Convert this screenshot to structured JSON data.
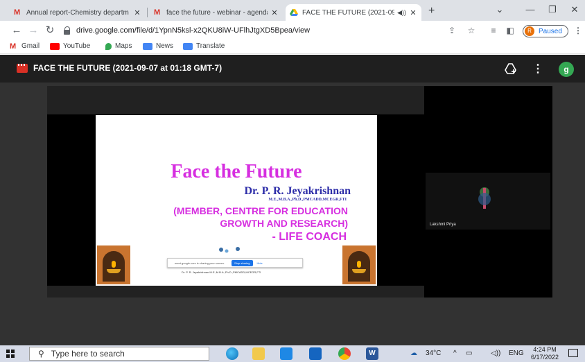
{
  "tabs": [
    {
      "title": "Annual report-Chemistry departm",
      "favicon": "gmail-icon"
    },
    {
      "title": "face the future - webinar - agenda",
      "favicon": "gmail-icon"
    },
    {
      "title": "FACE THE FUTURE (2021-09-",
      "favicon": "google-drive-icon",
      "active": true
    }
  ],
  "new_tab_label": "+",
  "address": {
    "url": "drive.google.com/file/d/1YpnN5ksl-x2QKU8iW-UFlhJtgXD5Bpea/view"
  },
  "profile": {
    "initial": "R",
    "status": "Paused"
  },
  "bookmarks": [
    "Gmail",
    "YouTube",
    "Maps",
    "News",
    "Translate"
  ],
  "viewer": {
    "file_title": "FACE THE FUTURE (2021-09-07 at 01:18 GMT-7)",
    "account_initial": "g"
  },
  "slide": {
    "heading": "Face the Future",
    "speaker": "Dr. P. R. Jeyakrishnan",
    "credentials": "M.E.,M.B.A.,Ph.D.,PMCADD,MCEGR,FTI",
    "role": "(MEMBER, CENTRE FOR EDUCATION GROWTH AND RESEARCH)",
    "role_line1": "(MEMBER, CENTRE FOR EDUCATION",
    "role_line2": "GROWTH AND RESEARCH)",
    "tagline": "- LIFE COACH",
    "footer": "Dr. P. R. Jeyakrishnan M.E.,M.B.A.,Ph.D.,PMCADD,MCEGR,FTI"
  },
  "share_bar": {
    "message": "meet.google.com is sharing your screen.",
    "stop_label": "Stop sharing",
    "hide_label": "Hide"
  },
  "participant": {
    "name": "Lakshmi Priya"
  },
  "taskbar": {
    "search_placeholder": "Type here to search",
    "weather": "34°C",
    "language": "ENG",
    "time": "4:24 PM",
    "date": "6/17/2022"
  },
  "colors": {
    "slide_pink": "#d62ee0",
    "slide_blue": "#2c2ca8",
    "paused_blue": "#1a73e8",
    "account_green": "#34a853"
  }
}
